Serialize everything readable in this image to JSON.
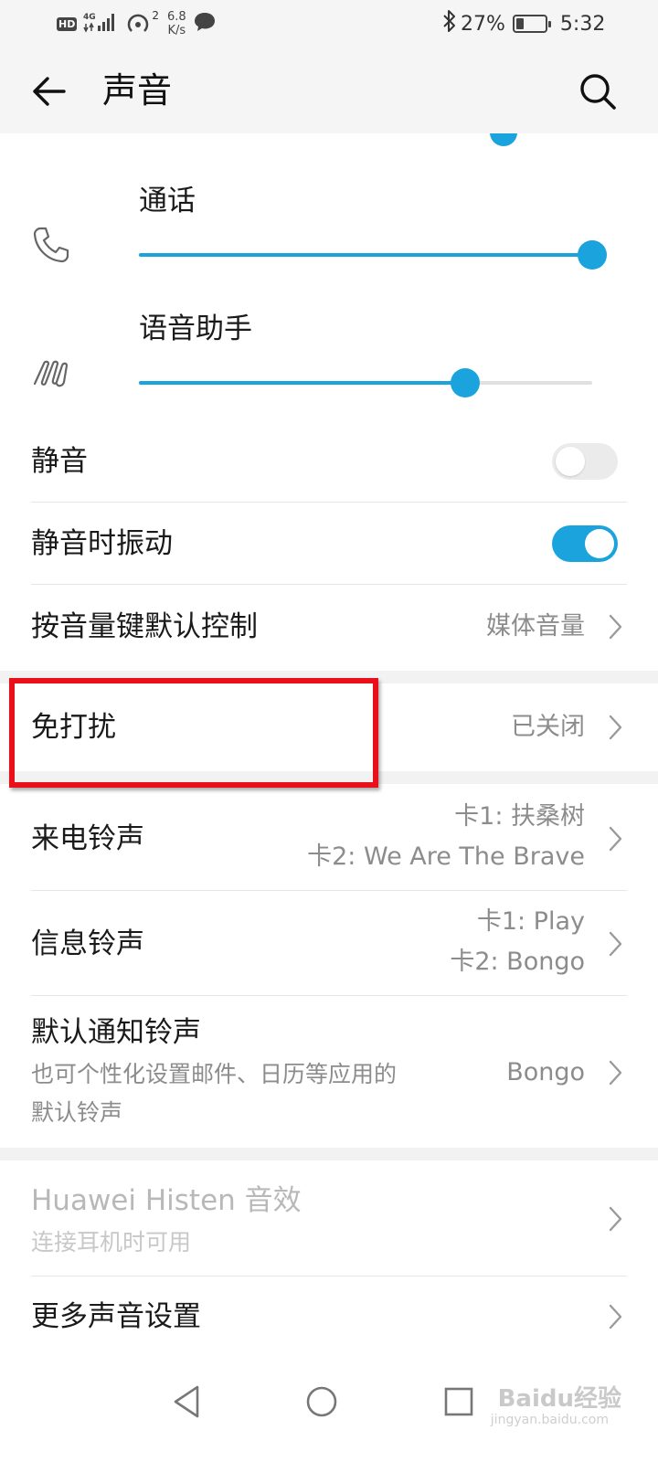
{
  "status_bar": {
    "hd": "HD",
    "network": "4G",
    "hotspot_count": "2",
    "speed_value": "6.8",
    "speed_unit": "K/s",
    "battery_text": "27%",
    "battery_level": 0.27,
    "time": "5:32"
  },
  "app_bar": {
    "title": "声音"
  },
  "volumes": [
    {
      "label": "通话",
      "icon": "phone-icon",
      "level": 1.0
    },
    {
      "label": "语音助手",
      "icon": "voice-assistant-icon",
      "level": 0.72
    }
  ],
  "settings": {
    "mute": {
      "label": "静音",
      "enabled": false
    },
    "vibrate_when_muted": {
      "label": "静音时振动",
      "enabled": true
    },
    "volume_key_default": {
      "label": "按音量键默认控制",
      "value": "媒体音量"
    },
    "do_not_disturb": {
      "label": "免打扰",
      "value": "已关闭"
    },
    "ringtone": {
      "label": "来电铃声",
      "value_line1": "卡1: 扶桑树",
      "value_line2": "卡2: We Are The Brave"
    },
    "message_tone": {
      "label": "信息铃声",
      "value_line1": "卡1: Play",
      "value_line2": "卡2: Bongo"
    },
    "notification_tone": {
      "label": "默认通知铃声",
      "subtitle_line1": "也可个性化设置邮件、日历等应用的",
      "subtitle_line2": "默认铃声",
      "value": "Bongo"
    },
    "histen": {
      "label": "Huawei Histen 音效",
      "subtitle": "连接耳机时可用"
    },
    "more_sound": {
      "label": "更多声音设置"
    }
  },
  "watermark": {
    "text": "Baidu经验",
    "sub": "jingyan.baidu.com"
  },
  "colors": {
    "accent": "#1aa3dc",
    "highlight": "#e8101b",
    "secondary_text": "#8c8c8c"
  }
}
